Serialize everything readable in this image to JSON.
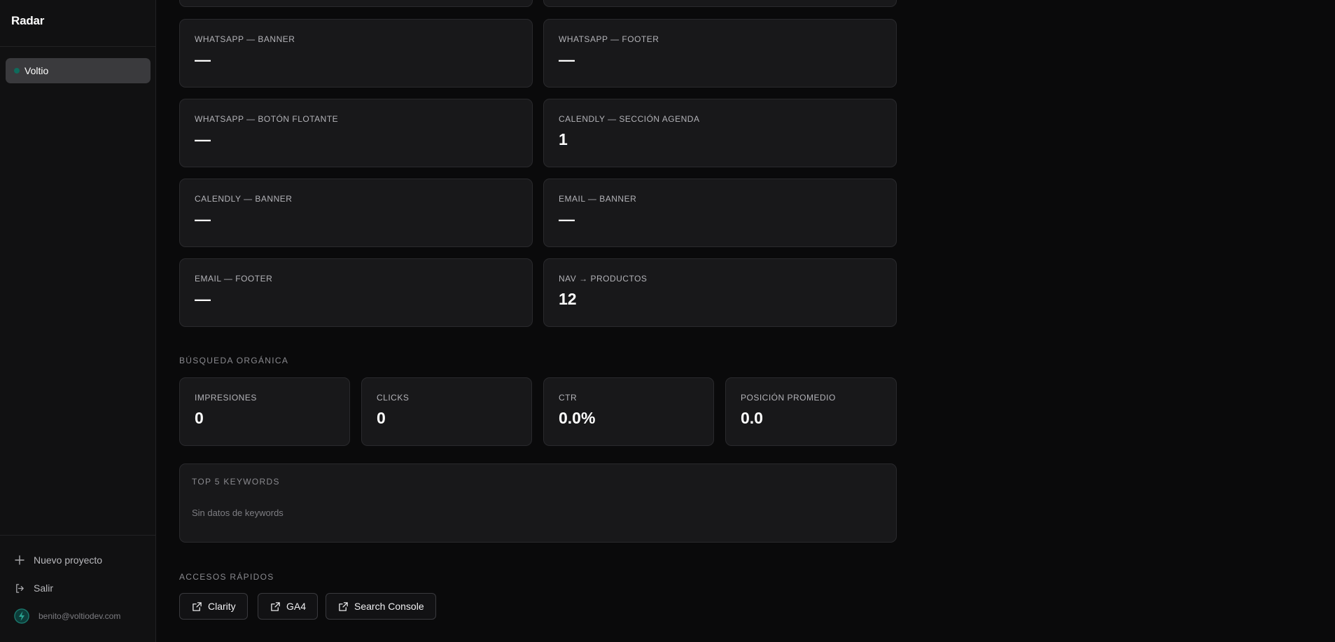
{
  "sidebar": {
    "brand": "Radar",
    "project": {
      "label": "Voltio",
      "status_color": "#0f6b5c"
    },
    "actions": [
      {
        "label": "Nuevo proyecto",
        "icon": "plus-icon"
      },
      {
        "label": "Salir",
        "icon": "logout-icon"
      }
    ],
    "user": {
      "email": "benito@voltiodev.com",
      "avatar_icon": "bolt-icon"
    }
  },
  "events": [
    {
      "label": "WHATSAPP — BANNER",
      "value": "—"
    },
    {
      "label": "WHATSAPP — FOOTER",
      "value": "—"
    },
    {
      "label": "WHATSAPP — BOTÓN FLOTANTE",
      "value": "—"
    },
    {
      "label": "CALENDLY — SECCIÓN AGENDA",
      "value": "1"
    },
    {
      "label": "CALENDLY — BANNER",
      "value": "—"
    },
    {
      "label": "EMAIL — BANNER",
      "value": "—"
    },
    {
      "label": "EMAIL — FOOTER",
      "value": "—"
    },
    {
      "label": "NAV → PRODUCTOS",
      "value": "12"
    }
  ],
  "organic": {
    "title": "BÚSQUEDA ORGÁNICA",
    "metrics": [
      {
        "label": "IMPRESIONES",
        "value": "0"
      },
      {
        "label": "CLICKS",
        "value": "0"
      },
      {
        "label": "CTR",
        "value": "0.0%"
      },
      {
        "label": "POSICIÓN PROMEDIO",
        "value": "0.0"
      }
    ]
  },
  "keywords": {
    "title": "TOP 5 KEYWORDS",
    "empty_text": "Sin datos de keywords"
  },
  "quick_access": {
    "title": "ACCESOS RÁPIDOS",
    "buttons": [
      {
        "label": "Clarity",
        "icon": "external-link-icon"
      },
      {
        "label": "GA4",
        "icon": "external-link-icon"
      },
      {
        "label": "Search Console",
        "icon": "external-link-icon"
      }
    ]
  },
  "colors": {
    "background": "#0a0a0b",
    "sidebar": "#111112",
    "card": "#18181a",
    "active_item": "#3a3a3d"
  }
}
